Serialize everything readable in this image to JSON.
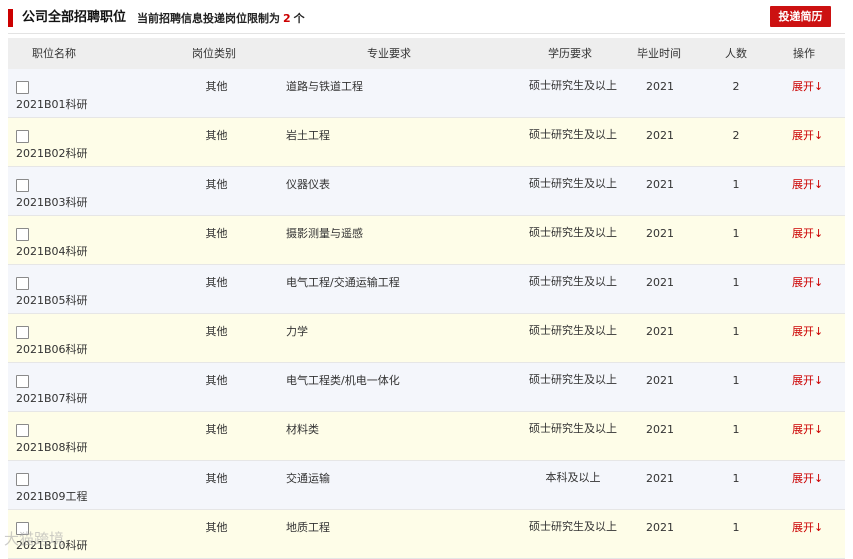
{
  "header": {
    "title": "公司全部招聘职位",
    "note_prefix": "当前招聘信息投递岗位限制为",
    "limit": "2",
    "note_suffix": "个",
    "submit_label": "投递简历"
  },
  "table": {
    "columns": [
      "职位名称",
      "岗位类别",
      "专业要求",
      "学历要求",
      "毕业时间",
      "人数",
      "操作"
    ],
    "rows": [
      {
        "code": "2021B01科研",
        "category": "其他",
        "major": "道路与铁道工程",
        "education": "硕士研究生及以上",
        "year": "2021",
        "count": "2",
        "action": "展开↓"
      },
      {
        "code": "2021B02科研",
        "category": "其他",
        "major": "岩土工程",
        "education": "硕士研究生及以上",
        "year": "2021",
        "count": "2",
        "action": "展开↓"
      },
      {
        "code": "2021B03科研",
        "category": "其他",
        "major": "仪器仪表",
        "education": "硕士研究生及以上",
        "year": "2021",
        "count": "1",
        "action": "展开↓"
      },
      {
        "code": "2021B04科研",
        "category": "其他",
        "major": "摄影测量与遥感",
        "education": "硕士研究生及以上",
        "year": "2021",
        "count": "1",
        "action": "展开↓"
      },
      {
        "code": "2021B05科研",
        "category": "其他",
        "major": "电气工程/交通运输工程",
        "education": "硕士研究生及以上",
        "year": "2021",
        "count": "1",
        "action": "展开↓"
      },
      {
        "code": "2021B06科研",
        "category": "其他",
        "major": "力学",
        "education": "硕士研究生及以上",
        "year": "2021",
        "count": "1",
        "action": "展开↓"
      },
      {
        "code": "2021B07科研",
        "category": "其他",
        "major": "电气工程类/机电一体化",
        "education": "硕士研究生及以上",
        "year": "2021",
        "count": "1",
        "action": "展开↓"
      },
      {
        "code": "2021B08科研",
        "category": "其他",
        "major": "材料类",
        "education": "硕士研究生及以上",
        "year": "2021",
        "count": "1",
        "action": "展开↓"
      },
      {
        "code": "2021B09工程",
        "category": "其他",
        "major": "交通运输",
        "education": "本科及以上",
        "year": "2021",
        "count": "1",
        "action": "展开↓"
      },
      {
        "code": "2021B10科研",
        "category": "其他",
        "major": "地质工程",
        "education": "硕士研究生及以上",
        "year": "2021",
        "count": "1",
        "action": "展开↓"
      }
    ]
  },
  "watermark": "大猫跨境"
}
